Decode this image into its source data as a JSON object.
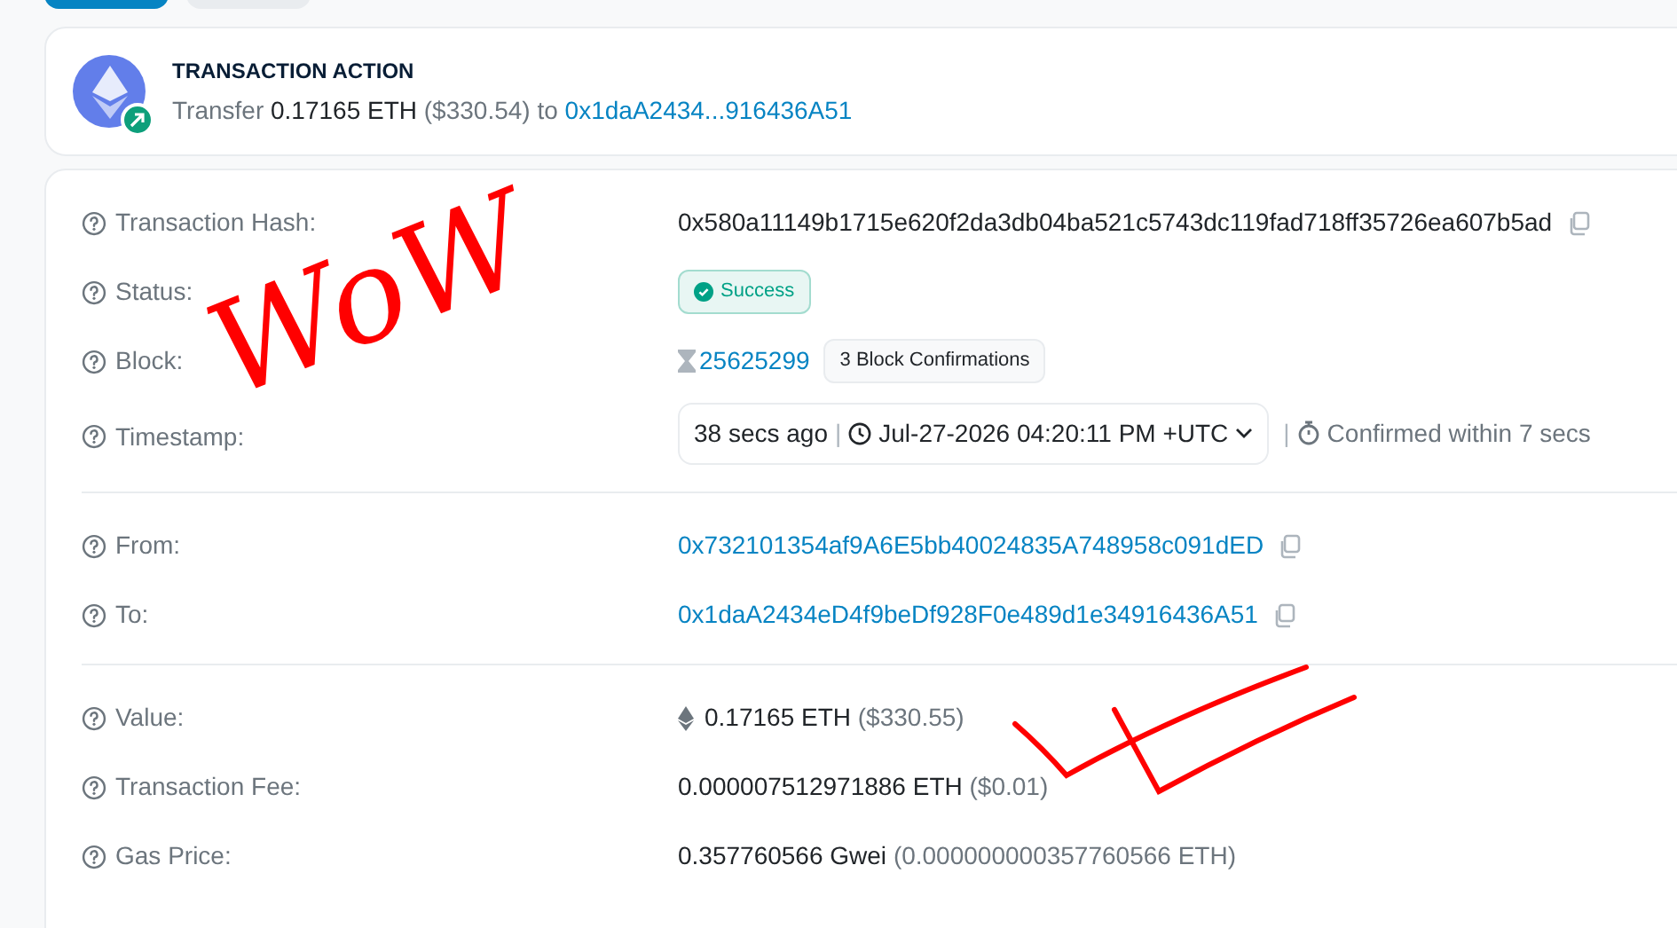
{
  "top_tabs": [
    {
      "selected": true
    },
    {
      "selected": false
    }
  ],
  "action": {
    "heading": "TRANSACTION ACTION",
    "verb": "Transfer",
    "amount": "0.17165 ETH",
    "usd": "($330.54)",
    "to_word": "to",
    "address": "0x1daA2434...916436A51"
  },
  "sections": [
    {
      "rows": [
        {
          "kind": "hash",
          "label": "Transaction Hash:",
          "value": "0x580a11149b1715e620f2da3db04ba521c5743dc119fad718ff35726ea607b5ad"
        },
        {
          "kind": "status",
          "label": "Status:",
          "status": {
            "label": "Success",
            "kind": "success"
          }
        },
        {
          "kind": "block",
          "label": "Block:",
          "value": "25625299",
          "badge": "3 Block Confirmations"
        },
        {
          "kind": "timestamp",
          "label": "Timestamp:",
          "ago": "38 secs ago",
          "separator": "|",
          "date": "Jul-27-2026 04:20:11 PM +UTC",
          "separator2": "|",
          "confirmed": "Confirmed within 7 secs"
        }
      ]
    },
    {
      "rows": [
        {
          "kind": "address",
          "label": "From:",
          "value": "0x732101354af9A6E5bb40024835A748958c091dED"
        },
        {
          "kind": "address",
          "label": "To:",
          "value": "0x1daA2434eD4f9beDf928F0e489d1e34916436A51"
        }
      ]
    },
    {
      "rows": [
        {
          "kind": "value",
          "label": "Value:",
          "value": "0.17165 ETH",
          "secondary": "($330.55)"
        },
        {
          "kind": "amount",
          "label": "Transaction Fee:",
          "value": "0.000007512971886 ETH",
          "secondary": "($0.01)"
        },
        {
          "kind": "amount",
          "label": "Gas Price:",
          "value": "0.357760566 Gwei",
          "secondary": "(0.000000000357760566 ETH)"
        }
      ]
    }
  ],
  "annotation": {
    "text": "WoW"
  }
}
